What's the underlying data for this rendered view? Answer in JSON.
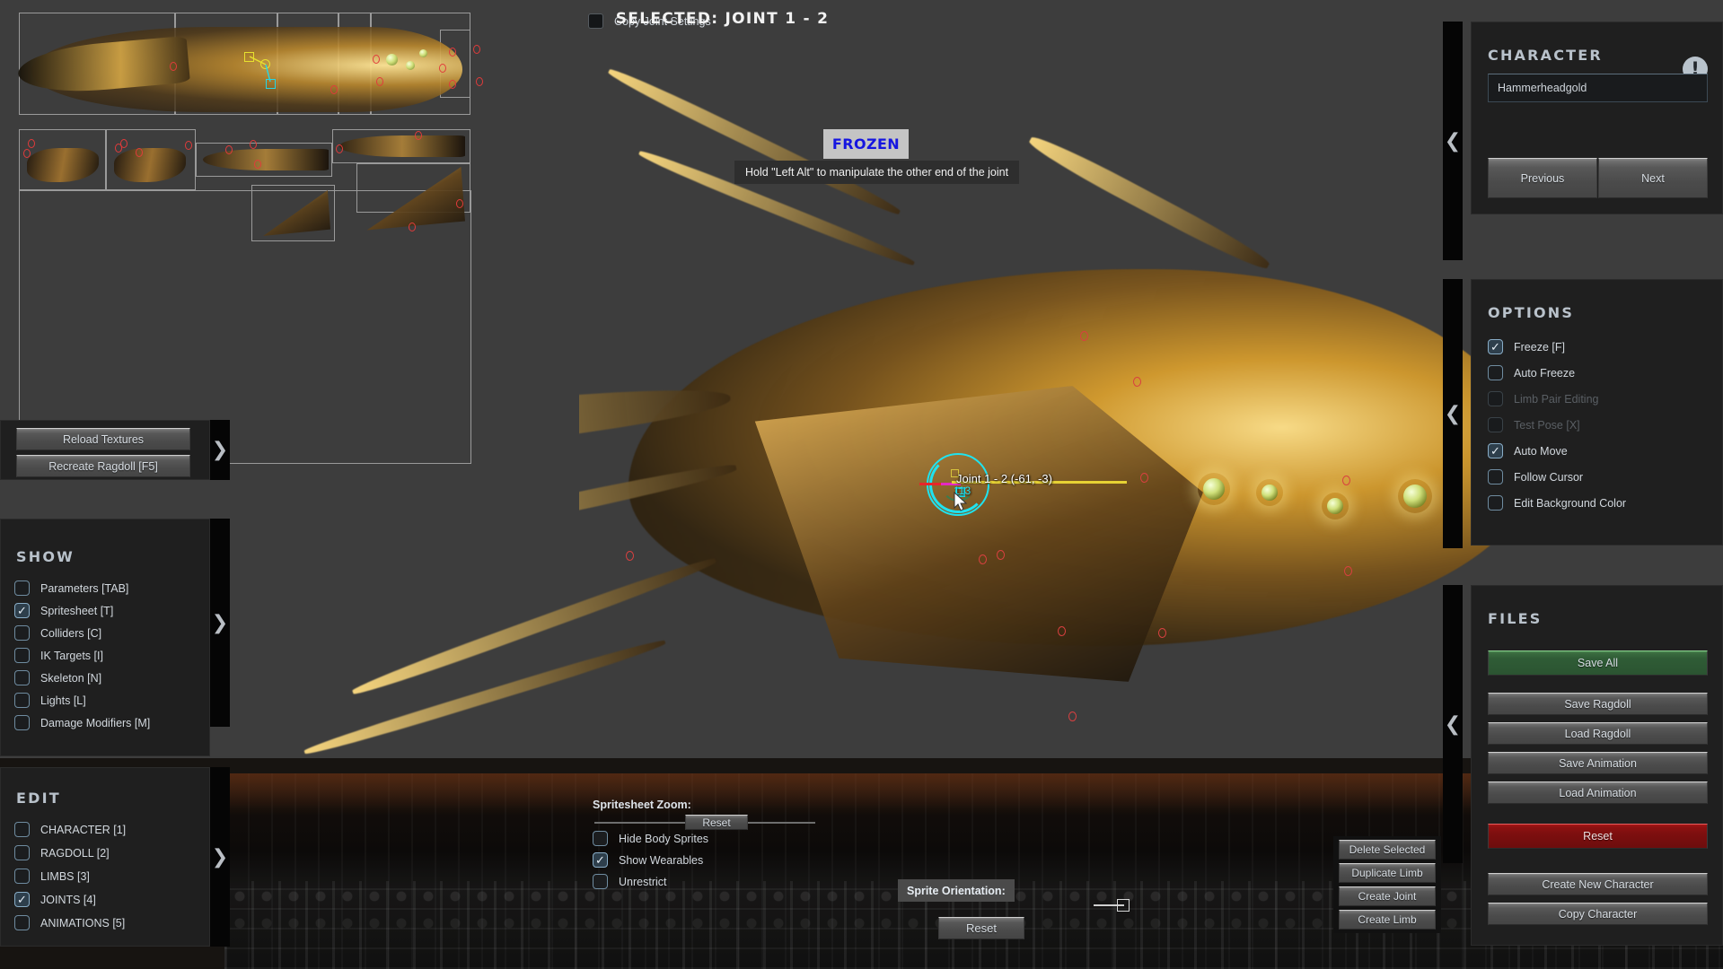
{
  "app": {
    "selected_title": "SELECTED: JOINT 1 - 2",
    "frozen_badge": "FROZEN",
    "frozen_hint": "Hold \"Left Alt\" to manipulate the other end of the joint",
    "copy_joint_settings": "Copy Joint Settings",
    "joint_label": "Joint 1 - 2 (-61, -3)",
    "joint_angle": "113",
    "accent_cyan": "#1fe3f0",
    "accent_yellow": "#e7d234",
    "accent_red": "#e8252b",
    "frozen_text_color": "#1515e0"
  },
  "character_panel": {
    "title": "CHARACTER",
    "alert_icon": "!",
    "name_value": "Hammerheadgold",
    "previous_label": "Previous",
    "next_label": "Next"
  },
  "options_panel": {
    "title": "OPTIONS",
    "items": [
      {
        "label": "Freeze [F]",
        "checked": true,
        "disabled": false
      },
      {
        "label": "Auto Freeze",
        "checked": false,
        "disabled": false
      },
      {
        "label": "Limb Pair Editing",
        "checked": false,
        "disabled": true
      },
      {
        "label": "Test Pose [X]",
        "checked": false,
        "disabled": true
      },
      {
        "label": "Auto Move",
        "checked": true,
        "disabled": false
      },
      {
        "label": "Follow Cursor",
        "checked": false,
        "disabled": false
      },
      {
        "label": "Edit Background Color",
        "checked": false,
        "disabled": false
      }
    ]
  },
  "files_panel": {
    "title": "FILES",
    "save_all": "Save All",
    "save_ragdoll": "Save Ragdoll",
    "load_ragdoll": "Load Ragdoll",
    "save_animation": "Save Animation",
    "load_animation": "Load Animation",
    "reset": "Reset",
    "create_new_character": "Create New Character",
    "copy_character": "Copy Character",
    "save_all_color": "#2f5c36",
    "reset_color": "#7d0f0f"
  },
  "tools_panel": {
    "reload_textures": "Reload Textures",
    "recreate_ragdoll": "Recreate Ragdoll [F5]"
  },
  "show_panel": {
    "title": "SHOW",
    "items": [
      {
        "label": "Parameters [TAB]",
        "checked": false
      },
      {
        "label": "Spritesheet [T]",
        "checked": true
      },
      {
        "label": "Colliders [C]",
        "checked": false
      },
      {
        "label": "IK Targets [I]",
        "checked": false
      },
      {
        "label": "Skeleton [N]",
        "checked": false
      },
      {
        "label": "Lights [L]",
        "checked": false
      },
      {
        "label": "Damage Modifiers [M]",
        "checked": false
      }
    ]
  },
  "edit_panel": {
    "title": "EDIT",
    "items": [
      {
        "label": "CHARACTER [1]",
        "checked": false
      },
      {
        "label": "RAGDOLL [2]",
        "checked": false
      },
      {
        "label": "LIMBS [3]",
        "checked": false
      },
      {
        "label": "JOINTS [4]",
        "checked": true
      },
      {
        "label": "ANIMATIONS [5]",
        "checked": false
      }
    ]
  },
  "bottom_bar": {
    "spritesheet_zoom_label": "Spritesheet Zoom:",
    "zoom_reset": "Reset",
    "checks": [
      {
        "label": "Hide Body Sprites",
        "checked": false
      },
      {
        "label": "Show Wearables",
        "checked": true
      },
      {
        "label": "Unrestrict",
        "checked": false
      }
    ],
    "sprite_orientation_label": "Sprite Orientation:",
    "sprite_orientation_reset": "Reset"
  },
  "limb_actions": {
    "delete_selected": "Delete Selected",
    "duplicate_limb": "Duplicate Limb",
    "create_joint": "Create Joint",
    "create_limb": "Create Limb"
  },
  "collapse_arrows": {
    "left": "❮",
    "right": "❯"
  }
}
